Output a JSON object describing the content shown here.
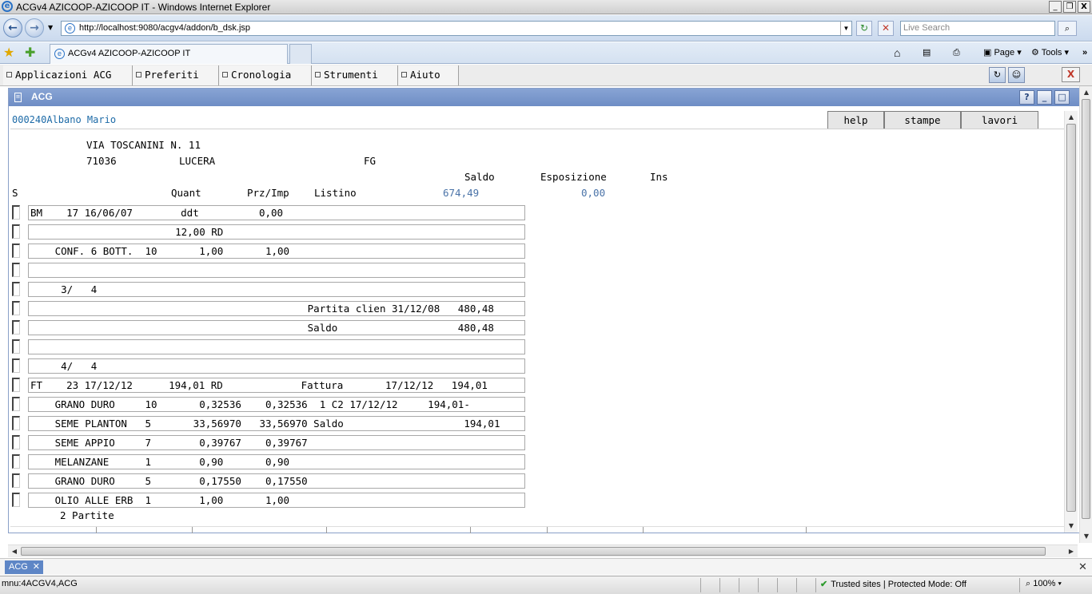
{
  "window": {
    "title": "ACGv4 AZICOOP-AZICOOP IT - Windows Internet Explorer",
    "minimize": "_",
    "maximize": "❐",
    "close": "X"
  },
  "nav": {
    "back": "←",
    "forward": "→",
    "url": "http://localhost:9080/acgv4/addon/b_dsk.jsp",
    "search_placeholder": "Live Search",
    "refresh": "↻",
    "stop": "✕",
    "search_button": "⌕"
  },
  "tabs": {
    "active_label": "ACGv4 AZICOOP-AZICOOP IT",
    "page_menu": "Page",
    "tools_menu": "Tools"
  },
  "app_menu": {
    "items": [
      "Applicazioni ACG",
      "Preferiti",
      "Cronologia",
      "Strumenti",
      "Aiuto"
    ],
    "close": "X"
  },
  "panel": {
    "title": "ACG",
    "help_icon": "?",
    "minimize": "_",
    "maximize": "□"
  },
  "customer": {
    "code_name": "000240Albano Mario",
    "address": "VIA TOSCANINI N. 11",
    "cap": "71036",
    "city": "LUCERA",
    "province": "FG"
  },
  "top_buttons": [
    "help",
    "stampe",
    "lavori"
  ],
  "summary": {
    "saldo_label": "Saldo",
    "esposizione_label": "Esposizione",
    "ins_label": "Ins",
    "saldo_value": "674,49",
    "esposizione_value": "0,00"
  },
  "columns": {
    "s": "S",
    "quant": "Quant",
    "prz_imp": "Prz/Imp",
    "listino": "Listino"
  },
  "rows": [
    [
      "BM    17 16/06/07        ddt          0,00"
    ],
    [
      "                       12,00 RD"
    ],
    [
      "   CONF. 6 BOTT.  10       1,00       1,00"
    ],
    [
      ""
    ],
    [
      "    3/   4"
    ],
    [
      "                                             Partita clien 31/12/08   480,48"
    ],
    [
      "                                             Saldo                    480,48"
    ],
    [
      ""
    ],
    [
      "    4/   4"
    ],
    [
      "FT    23 17/12/12      194,01 RD             Fattura       17/12/12   194,01"
    ],
    [
      "   GRANO DURO     10       0,32536    0,32536  1 C2 17/12/12     194,01-"
    ],
    [
      "   SEME PLANTON   5       33,56970   33,56970 Saldo                    194,01"
    ],
    [
      "   SEME APPIO     7        0,39767    0,39767"
    ],
    [
      "   MELANZANE      1        0,90       0,90"
    ],
    [
      "   GRANO DURO     5        0,17550    0,17550"
    ],
    [
      "   OLIO ALLE ERB  1        1,00       1,00"
    ]
  ],
  "footer_text": "2 Partite",
  "bottom_tab": {
    "label": "ACG",
    "close": "✕"
  },
  "status": {
    "left_text": "mnu:4ACGV4,ACG",
    "zone_text": "Trusted sites | Protected Mode: Off",
    "zoom_text": "100%"
  }
}
